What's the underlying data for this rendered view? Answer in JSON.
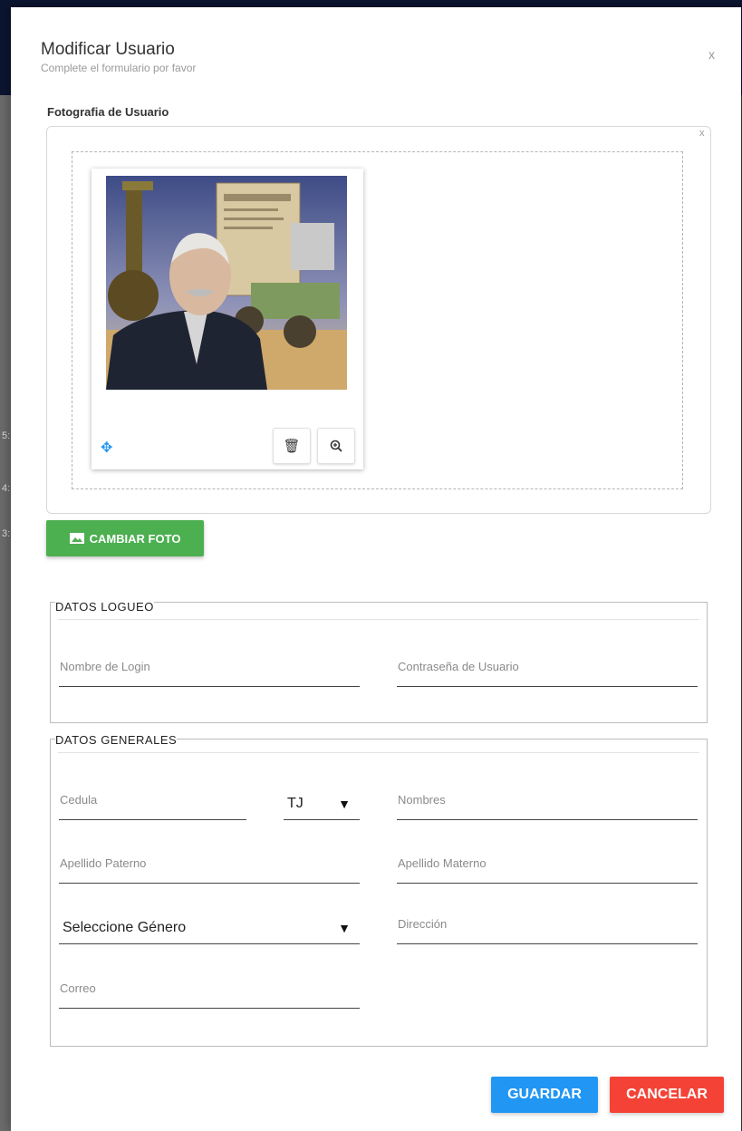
{
  "backdrop": {
    "side_numbers": [
      "5:",
      "4:",
      "3:"
    ]
  },
  "modal": {
    "title": "Modificar Usuario",
    "subtitle": "Complete el formulario por favor",
    "close_label": "x"
  },
  "photo": {
    "label": "Fotografia de Usuario",
    "box_close_label": "x",
    "move_icon": "move-icon",
    "delete_icon": "trash-icon",
    "zoom_icon": "zoom-in-icon",
    "change_button_label": "CAMBIAR FOTO",
    "change_button_icon": "image-icon"
  },
  "login_section": {
    "legend": "DATOS LOGUEO",
    "login_placeholder": "Nombre de Login",
    "password_placeholder": "Contraseña de Usuario"
  },
  "general_section": {
    "legend": "DATOS GENERALES",
    "cedula_placeholder": "Cedula",
    "cedula_type_value": "TJ",
    "nombres_placeholder": "Nombres",
    "apellido_paterno_placeholder": "Apellido Paterno",
    "apellido_materno_placeholder": "Apellido Materno",
    "genero_value": "Seleccione Género",
    "direccion_placeholder": "Dirección",
    "correo_placeholder": "Correo"
  },
  "actions": {
    "save_label": "GUARDAR",
    "cancel_label": "CANCELAR"
  },
  "colors": {
    "primary": "#2196f3",
    "success": "#4caf50",
    "danger": "#f44336",
    "header_bg": "#0c1530"
  }
}
